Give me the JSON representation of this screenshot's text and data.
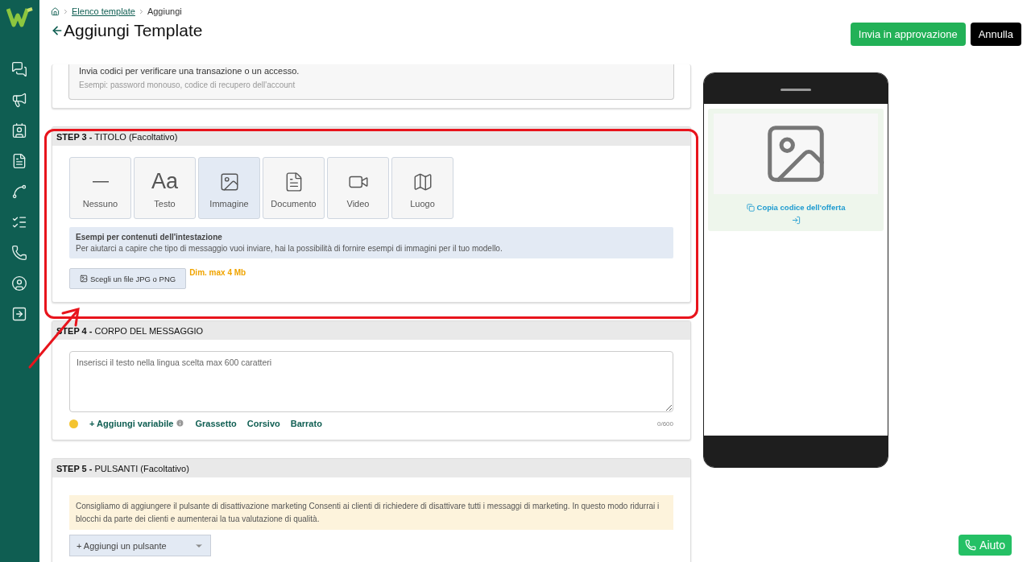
{
  "breadcrumb": [
    {
      "label": "Elenco template",
      "link": true
    },
    {
      "label": "Aggiungi",
      "link": false
    }
  ],
  "title": "Aggiungi Template",
  "actions": [
    {
      "label": "Invia in approvazione",
      "kind": "primary"
    },
    {
      "label": "Annulla",
      "kind": "dark"
    }
  ],
  "category_card": {
    "title": "Invia codici per verificare una transazione o un accesso.",
    "example": "Esempi: password monouso, codice di recupero dell'account"
  },
  "step3": {
    "heading": "**STEP 3 -** TITOLO (Facoltativo)",
    "highlighted": true,
    "options": [
      {
        "label": "Nessuno",
        "kind": "none",
        "selected": false
      },
      {
        "label": "Testo",
        "kind": "text",
        "symbol": "Aa",
        "selected": false
      },
      {
        "label": "Immagine",
        "kind": "image",
        "selected": true
      },
      {
        "label": "Documento",
        "kind": "document",
        "selected": false
      },
      {
        "label": "Video",
        "kind": "video",
        "selected": false
      },
      {
        "label": "Luogo",
        "kind": "location",
        "selected": false
      }
    ],
    "info": {
      "title": "Esempi per contenuti dell'intestazione",
      "text": "Per aiutarci a capire che tipo di messaggio vuoi inviare, hai la possibilità di fornire esempi di immagini per il tuo modello."
    },
    "upload": {
      "label": "Scegli un file JPG o PNG",
      "hint": "Dim. max 4 Mb"
    }
  },
  "step4": {
    "heading": "**STEP 4 -** CORPO DEL MESSAGGIO",
    "placeholder": "Inserisci il testo nella lingua scelta max 600 caratteri",
    "tools": [
      {
        "label": "+ Aggiungi variabile",
        "info": true
      },
      {
        "label": "Grassetto",
        "info": false
      },
      {
        "label": "Corsivo",
        "info": false
      },
      {
        "label": "Barrato",
        "info": false
      }
    ],
    "counter": "0/600"
  },
  "step5": {
    "heading": "**STEP 5 -** PULSANTI (Facoltativo)",
    "notice": "Consigliamo di aggiungere il pulsante di disattivazione marketing Consenti ai clienti di richiedere di disattivare tutti i messaggi di marketing. In questo modo ridurrai i blocchi da parte dei clienti e aumenterai la tua valutazione di qualità.",
    "add_button": "+ Aggiungi un pulsante"
  },
  "preview": {
    "link": "Copia codice dell'offerta"
  },
  "help": {
    "label": "Aiuto"
  }
}
